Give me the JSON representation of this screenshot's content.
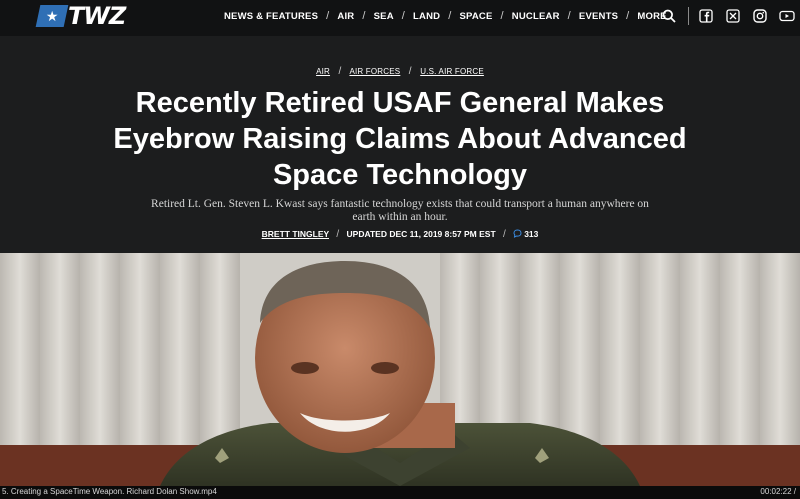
{
  "brand": {
    "logo_text": "TWZ",
    "logo_star": "★"
  },
  "nav": {
    "items": [
      "NEWS & FEATURES",
      "AIR",
      "SEA",
      "LAND",
      "SPACE",
      "NUCLEAR",
      "EVENTS",
      "MORE"
    ],
    "separator": "/"
  },
  "tools": {
    "search_icon": "search-icon",
    "socials": [
      "facebook-icon",
      "x-icon",
      "instagram-icon",
      "youtube-icon"
    ]
  },
  "article": {
    "breadcrumbs": [
      "AIR",
      "AIR FORCES",
      "U.S. AIR FORCE"
    ],
    "title": "Recently Retired USAF General Makes Eyebrow Raising Claims About Advanced Space Technology",
    "dek": "Retired Lt. Gen. Steven L. Kwast says fantastic technology exists that could transport a human anywhere on earth within an hour.",
    "author": "BRETT TINGLEY",
    "updated": "UPDATED DEC 11, 2019 8:57 PM EST",
    "comments": "313"
  },
  "player": {
    "filename": "5. Creating a SpaceTime Weapon. Richard Dolan Show.mp4",
    "timecode": "00:02:22 /"
  },
  "colors": {
    "brand_blue": "#2f6fb5",
    "header_bg": "#1c1d1e",
    "topbar_bg": "#111213"
  }
}
